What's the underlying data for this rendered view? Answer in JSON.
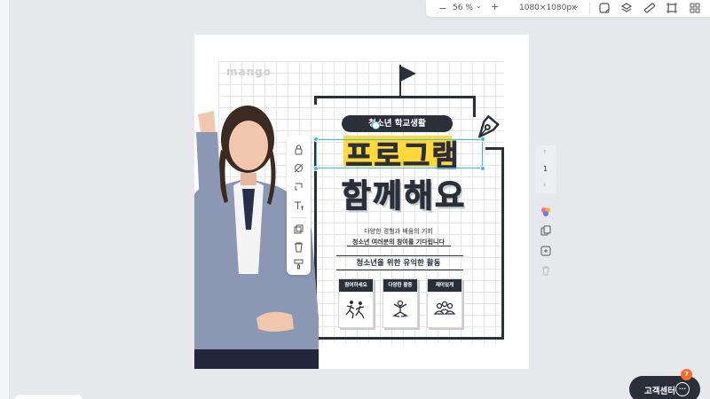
{
  "toolbar": {
    "zoom_out": "−",
    "zoom_value": "56 %",
    "zoom_dropdown": "⌄",
    "zoom_in": "+",
    "canvas_size": "1080×1080px",
    "size_dropdown": "⌄"
  },
  "design": {
    "logo": "mango",
    "pill_title": "청소년 학교생활",
    "headline_1": "프로그램",
    "headline_2": "함께해요",
    "subtitle_1": "다양한 경험과 배움의 기회",
    "subtitle_2": "청소년 여러분의 참여를 기다립니다",
    "section_title": "청소년을 위한 유익한 활동",
    "cards": [
      {
        "label": "참여하세요",
        "icon": "running-people-icon"
      },
      {
        "label": "다양한 활동",
        "icon": "meditation-person-icon"
      },
      {
        "label": "재미있게",
        "icon": "group-people-icon"
      }
    ],
    "colors": {
      "dark": "#2b2f3a",
      "highlight": "#ffd83b",
      "selection": "#39c0d8"
    }
  },
  "page_control": {
    "up": "↑",
    "number": "1",
    "down": "↓"
  },
  "support": {
    "label": "고객센터",
    "badge": "7"
  }
}
